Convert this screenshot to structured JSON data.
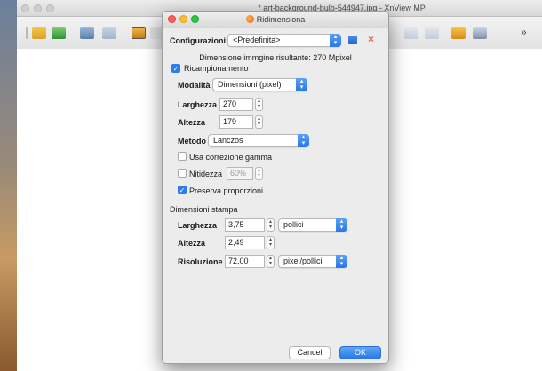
{
  "app": {
    "title": "* art-background-bulb-544947.jpg - XnView MP",
    "overflow_label": "»"
  },
  "dialog": {
    "title": "Ridimensiona",
    "config_label": "Configurazioni:",
    "config_value": "<Predefinita>",
    "result_text": "Dimensione immgine risultante: 270 Mpixel",
    "resample_label": "Ricampionamento",
    "resample_checked": true,
    "mode_label": "Modalità",
    "mode_value": "Dimensioni (pixel)",
    "width_label": "Larghezza",
    "width_value": "270",
    "height_label": "Altezza",
    "height_value": "179",
    "method_label": "Metodo",
    "method_value": "Lanczos",
    "gamma_label": "Usa correzione gamma",
    "gamma_checked": false,
    "sharpness_label": "Nitidezza",
    "sharpness_value": "60%",
    "sharpness_checked": false,
    "preserve_label": "Preserva proporzioni",
    "preserve_checked": true,
    "print_section": "Dimensioni stampa",
    "print_width_label": "Larghezza",
    "print_width_value": "3,75",
    "print_unit_value": "pollici",
    "print_height_label": "Altezza",
    "print_height_value": "2,49",
    "resolution_label": "Risoluzione",
    "resolution_value": "72,00",
    "resolution_unit_value": "pixel/pollici",
    "cancel_label": "Cancel",
    "ok_label": "OK"
  },
  "colors": {
    "accent": "#2f7de9",
    "close": "#fe5f57",
    "minimize": "#febc2e",
    "zoom": "#28c840"
  }
}
